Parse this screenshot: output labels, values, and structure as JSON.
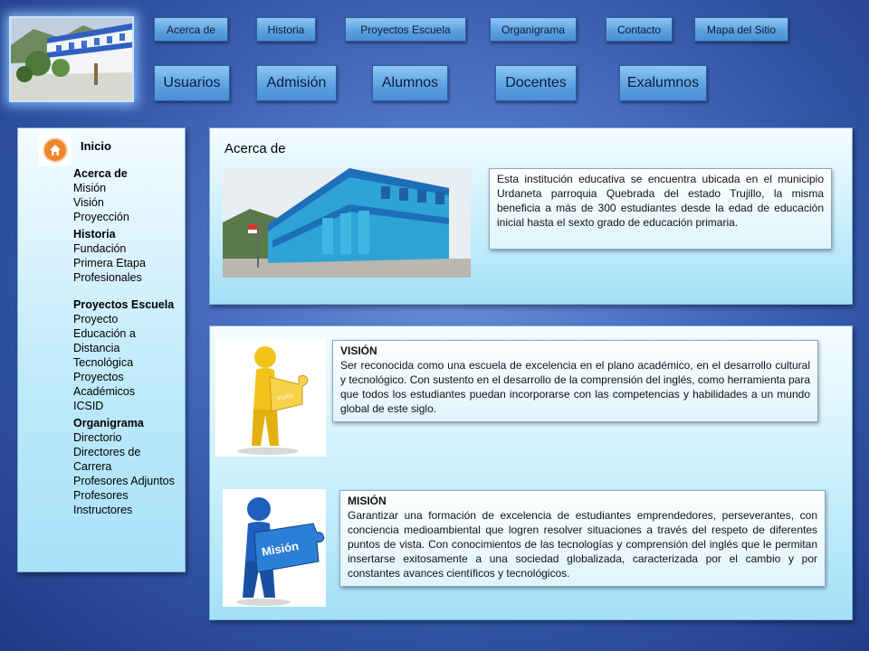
{
  "top_nav": [
    "Acerca de",
    "Historia",
    "Proyectos Escuela",
    "Organigrama",
    "Contacto",
    "Mapa del Sitio"
  ],
  "main_nav": [
    "Usuarios",
    "Admisión",
    "Alumnos",
    "Docentes",
    "Exalumnos"
  ],
  "sidebar": {
    "home_label": "Inicio",
    "groups": [
      {
        "title": "Acerca de",
        "items": [
          "Misión",
          "Visión",
          "Proyección"
        ]
      },
      {
        "title": "Historia",
        "items": [
          "Fundación",
          "Primera Etapa",
          "Profesionales"
        ]
      },
      {
        "title": "Proyectos Escuela",
        "items": [
          "Proyecto",
          "Educación a Distancia",
          "Tecnológica",
          "Proyectos Académicos",
          "ICSID"
        ]
      },
      {
        "title": "Organigrama",
        "items": [
          "Directorio",
          "Directores de Carrera",
          "Profesores Adjuntos",
          "Profesores Instructores"
        ]
      }
    ]
  },
  "about": {
    "title": "Acerca de",
    "text": "Esta institución educativa se encuentra ubicada en el municipio Urdaneta parroquia Quebrada del estado Trujillo, la misma beneficia a más de 300 estudiantes desde la edad de educación inicial hasta el sexto grado de educación primaria."
  },
  "vision": {
    "heading": "VISIÓN",
    "puzzle_label": "Visión",
    "text": "Ser reconocida como una escuela de excelencia en el plano académico, en el desarrollo cultural y tecnológico. Con sustento en el desarrollo de la comprensión del inglés, como herramienta para que todos los estudiantes puedan incorporarse con las competencias y habilidades a un mundo global de este siglo."
  },
  "mission": {
    "heading": "MISIÓN",
    "puzzle_label": "Misión",
    "text": "Garantizar una formación de excelencia de estudiantes emprendedores, perseverantes, con conciencia medioambiental que logren resolver situaciones a través del respeto de diferentes puntos de vista. Con conocimientos de las tecnologías y comprensión del inglés que le permitan insertarse exitosamente a una sociedad globalizada, caracterizada por el cambio y por constantes avances científicos y tecnológicos."
  },
  "colors": {
    "background": "#2f4fa0",
    "button": "#5aa0e0",
    "panel": "#c8effc",
    "home_icon": "#f0852a"
  }
}
